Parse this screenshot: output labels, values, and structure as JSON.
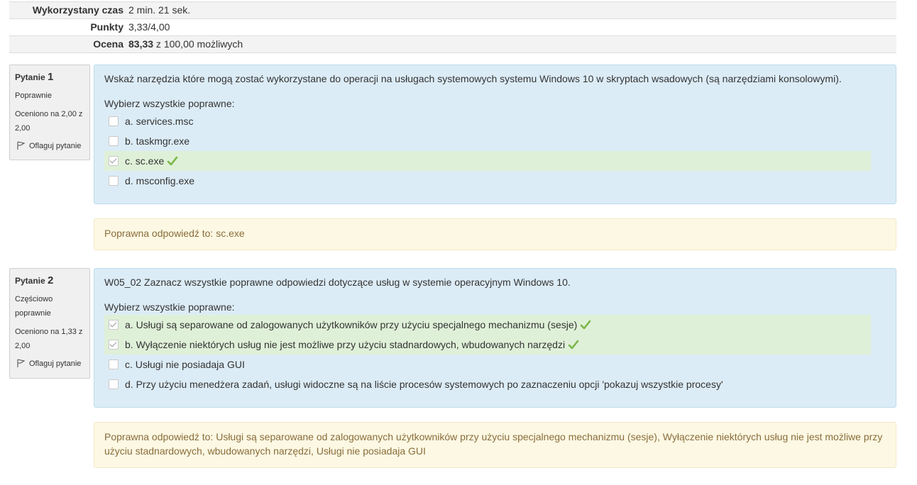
{
  "summary": [
    {
      "label": "Wykorzystany czas",
      "value": "2 min. 21 sek."
    },
    {
      "label": "Punkty",
      "value": "3,33/4,00"
    },
    {
      "label": "Ocena",
      "value_bold": "83,33",
      "value_rest": " z 100,00 możliwych"
    }
  ],
  "questions": [
    {
      "label": "Pytanie",
      "number": "1",
      "state": "Poprawnie",
      "grade": "Oceniono na 2,00 z 2,00",
      "flag": "Oflaguj pytanie",
      "text": "Wskaż narzędzia które mogą zostać wykorzystane do operacji na usługach systemowych systemu Windows 10 w skryptach wsadowych (są narzędziami konsolowymi).",
      "prompt": "Wybierz wszystkie poprawne:",
      "answers": [
        {
          "label": "a. services.msc",
          "checked": false,
          "correct": false
        },
        {
          "label": "b. taskmgr.exe",
          "checked": false,
          "correct": false
        },
        {
          "label": "c. sc.exe",
          "checked": true,
          "correct": true
        },
        {
          "label": "d. msconfig.exe",
          "checked": false,
          "correct": false
        }
      ],
      "feedback": "Poprawna odpowiedź to: sc.exe"
    },
    {
      "label": "Pytanie",
      "number": "2",
      "state": "Częściowo poprawnie",
      "grade": "Oceniono na 1,33 z 2,00",
      "flag": "Oflaguj pytanie",
      "text": "W05_02 Zaznacz wszystkie poprawne odpowiedzi dotyczące usług w systemie operacyjnym Windows 10.",
      "prompt": "Wybierz wszystkie poprawne:",
      "answers": [
        {
          "label": "a. Usługi są separowane od zalogowanych użytkowników przy użyciu specjalnego mechanizmu (sesje)",
          "checked": true,
          "correct": true
        },
        {
          "label": "b. Wyłączenie niektórych usług nie jest możliwe przy użyciu stadnardowych, wbudowanych narzędzi",
          "checked": true,
          "correct": true
        },
        {
          "label": "c. Usługi nie posiadaja GUI",
          "checked": false,
          "correct": false
        },
        {
          "label": "d. Przy użyciu menedżera zadań, usługi widoczne są na liście procesów systemowych po zaznaczeniu opcji 'pokazuj wszystkie procesy'",
          "checked": false,
          "correct": false
        }
      ],
      "feedback": "Poprawna odpowiedź to: Usługi są separowane od zalogowanych użytkowników przy użyciu specjalnego mechanizmu (sesje), Wyłączenie niektórych usług nie jest możliwe przy użyciu stadnardowych, wbudowanych narzędzi, Usługi nie posiadaja GUI"
    }
  ],
  "colors": {
    "content_bg": "#dcecf6",
    "correct_bg": "#dff0d8",
    "feedback_bg": "#fcf8e3",
    "feedback_text": "#8a6d3b",
    "tick": "#7ab648"
  },
  "icons": {
    "flag": "flag-icon",
    "tick": "check-icon"
  }
}
